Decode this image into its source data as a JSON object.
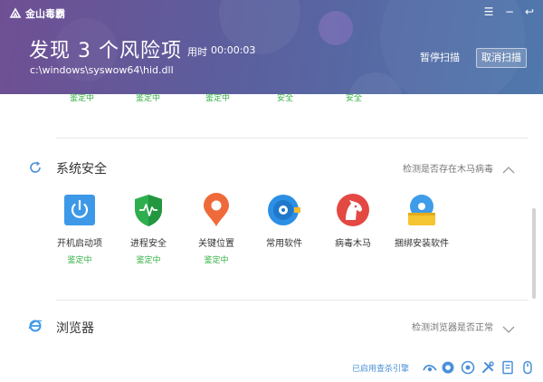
{
  "app": {
    "name": "金山毒霸"
  },
  "window": {
    "menu_icon": "menu-icon",
    "minimize_icon": "minimize-icon",
    "back_icon": "back-icon"
  },
  "header": {
    "title": "发现 3 个风险项",
    "elapsed_label": "用时",
    "elapsed_value": "00:00:03",
    "current_file": "c:\\windows\\syswow64\\hid.dll",
    "pause_label": "暂停扫描",
    "cancel_label": "取消扫描"
  },
  "previous_row": {
    "statuses": [
      "鉴定中",
      "鉴定中",
      "鉴定中",
      "安全",
      "安全"
    ]
  },
  "sections": [
    {
      "title": "系统安全",
      "description": "检测是否存在木马病毒",
      "expanded": true,
      "items": [
        {
          "label": "开机启动项",
          "status": "鉴定中",
          "icon": "power-icon"
        },
        {
          "label": "进程安全",
          "status": "鉴定中",
          "icon": "shield-pulse-icon"
        },
        {
          "label": "关键位置",
          "status": "鉴定中",
          "icon": "location-pin-icon"
        },
        {
          "label": "常用软件",
          "status": "",
          "icon": "disc-icon"
        },
        {
          "label": "病毒木马",
          "status": "",
          "icon": "trojan-horse-icon"
        },
        {
          "label": "捆绑安装软件",
          "status": "",
          "icon": "bundle-disc-icon"
        }
      ]
    },
    {
      "title": "浏览器",
      "description": "检测浏览器是否正常",
      "expanded": false
    }
  ],
  "footer": {
    "status_text": "已启用查杀引擎",
    "icons": [
      "engine-icon-1",
      "engine-icon-2",
      "engine-icon-3",
      "tools-icon",
      "report-icon",
      "mouse-icon"
    ]
  },
  "colors": {
    "header_start": "#6f4f93",
    "header_end": "#4f78ad",
    "accent": "#4a90d9",
    "status_green": "#32b043"
  }
}
